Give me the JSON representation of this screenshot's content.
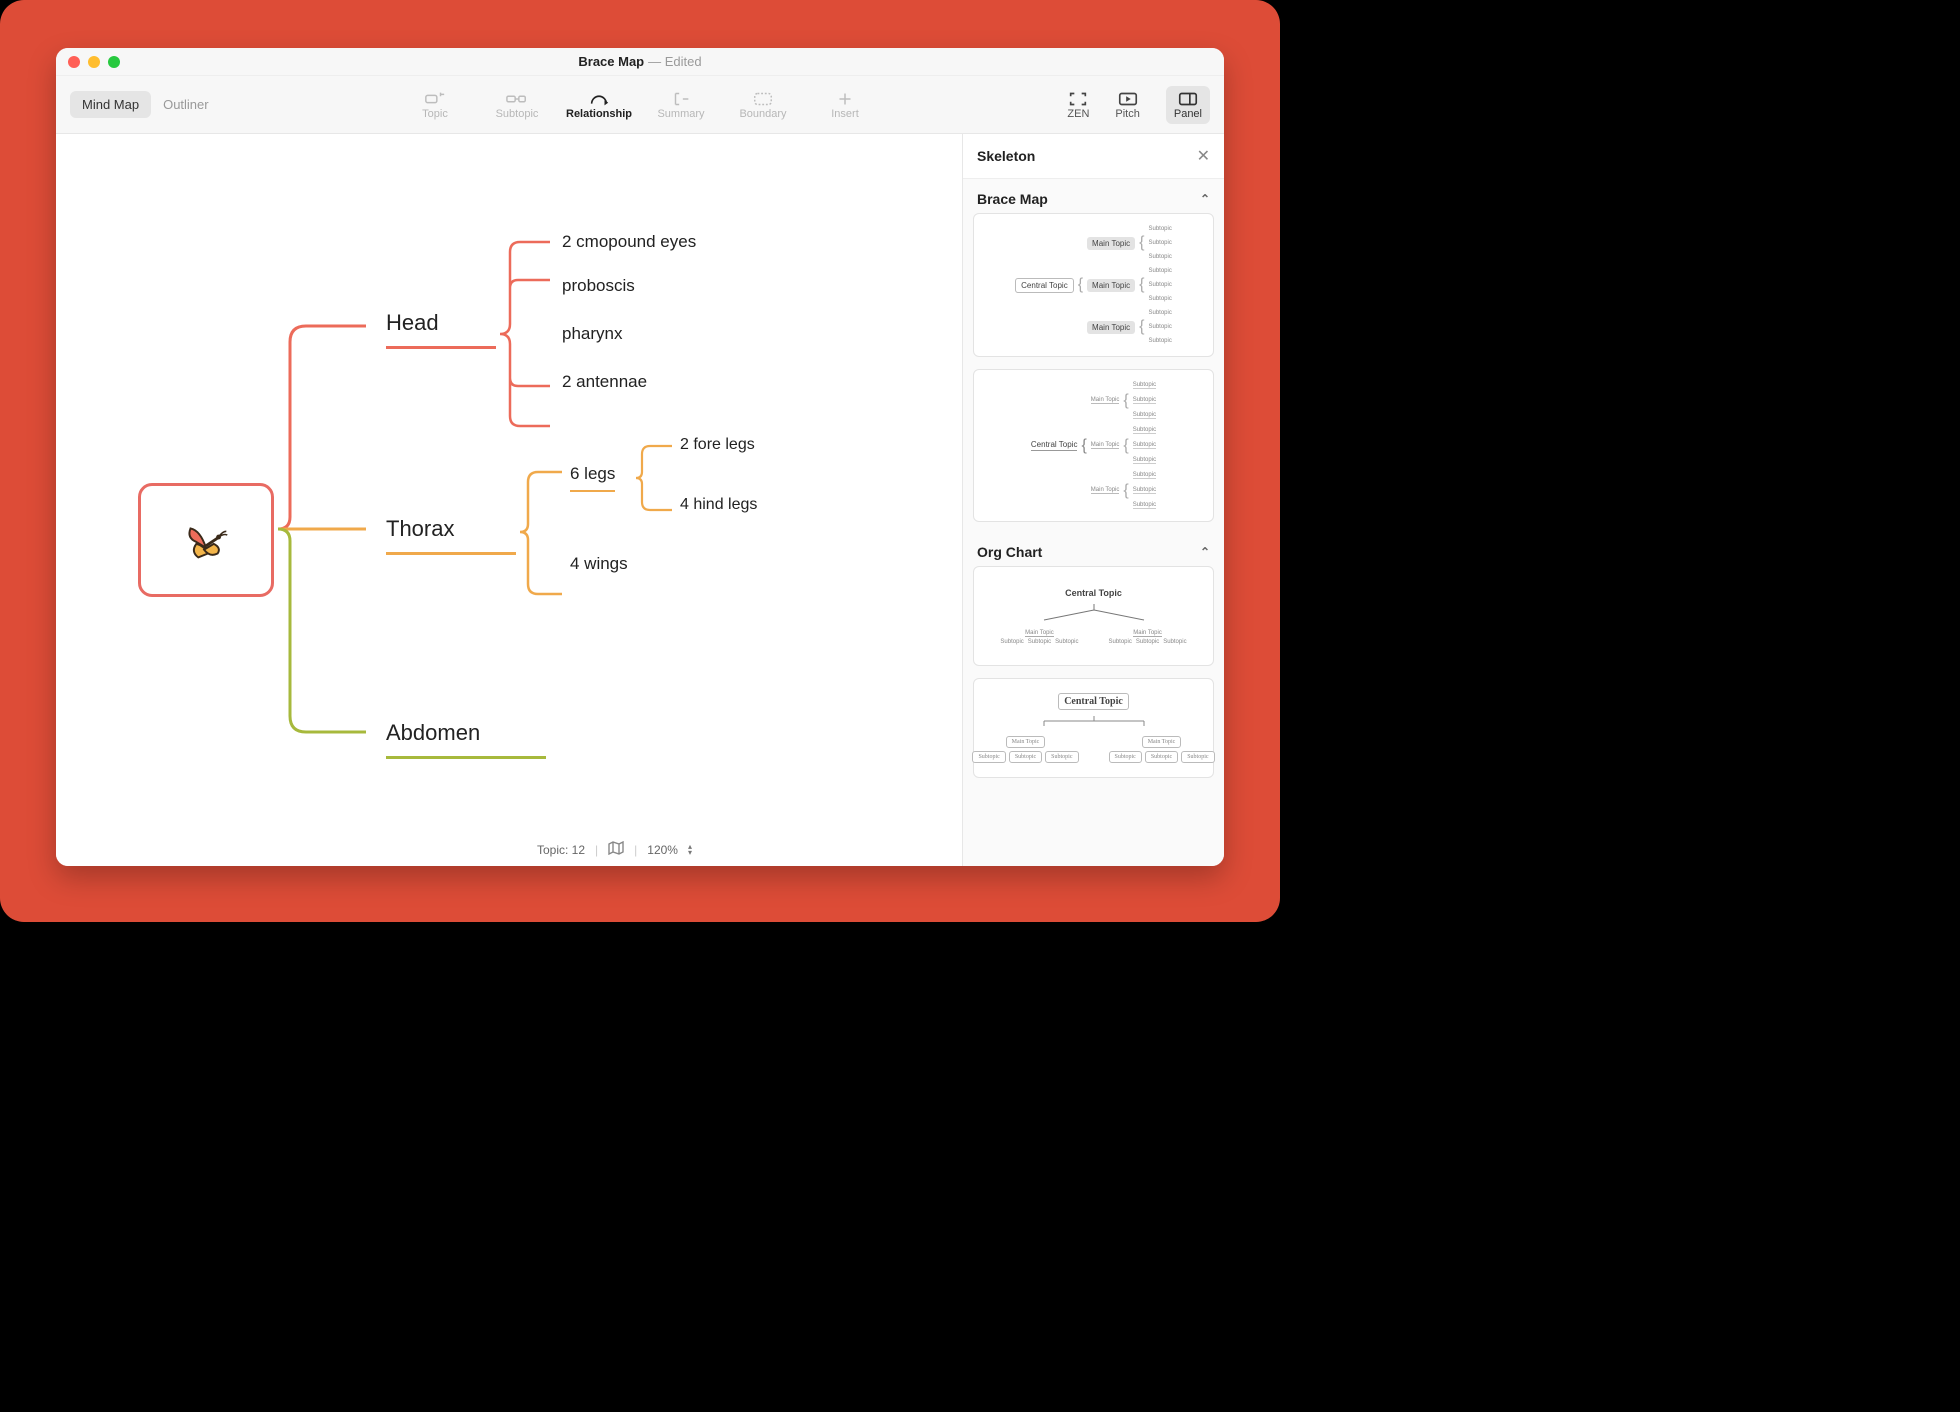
{
  "window": {
    "title": "Brace Map",
    "subtitle": "— Edited"
  },
  "viewTabs": {
    "mindmap": "Mind Map",
    "outliner": "Outliner"
  },
  "tools": {
    "topic": "Topic",
    "subtopic": "Subtopic",
    "relationship": "Relationship",
    "summary": "Summary",
    "boundary": "Boundary",
    "insert": "Insert"
  },
  "rightTools": {
    "zen": "ZEN",
    "pitch": "Pitch",
    "panel": "Panel"
  },
  "sidePanel": {
    "title": "Skeleton",
    "cats": {
      "brace": "Brace Map",
      "org": "Org Chart"
    },
    "thumb": {
      "central": "Central Topic",
      "main": "Main Topic",
      "sub": "Subtopic"
    }
  },
  "map": {
    "branches": {
      "head": {
        "label": "Head",
        "subs": [
          "2 cmopound eyes",
          "proboscis",
          "pharynx",
          "2 antennae"
        ]
      },
      "thorax": {
        "label": "Thorax",
        "subs": {
          "legs": {
            "label": "6 legs",
            "subs": [
              "2 fore legs",
              "4 hind legs"
            ]
          },
          "wings": "4 wings"
        }
      },
      "abdomen": {
        "label": "Abdomen"
      }
    }
  },
  "status": {
    "topicCount": "Topic: 12",
    "zoom": "120%"
  },
  "colors": {
    "head": "#ec6b5a",
    "thorax": "#f0a94b",
    "abdomen": "#a7b93c",
    "root": "#e86b63"
  }
}
